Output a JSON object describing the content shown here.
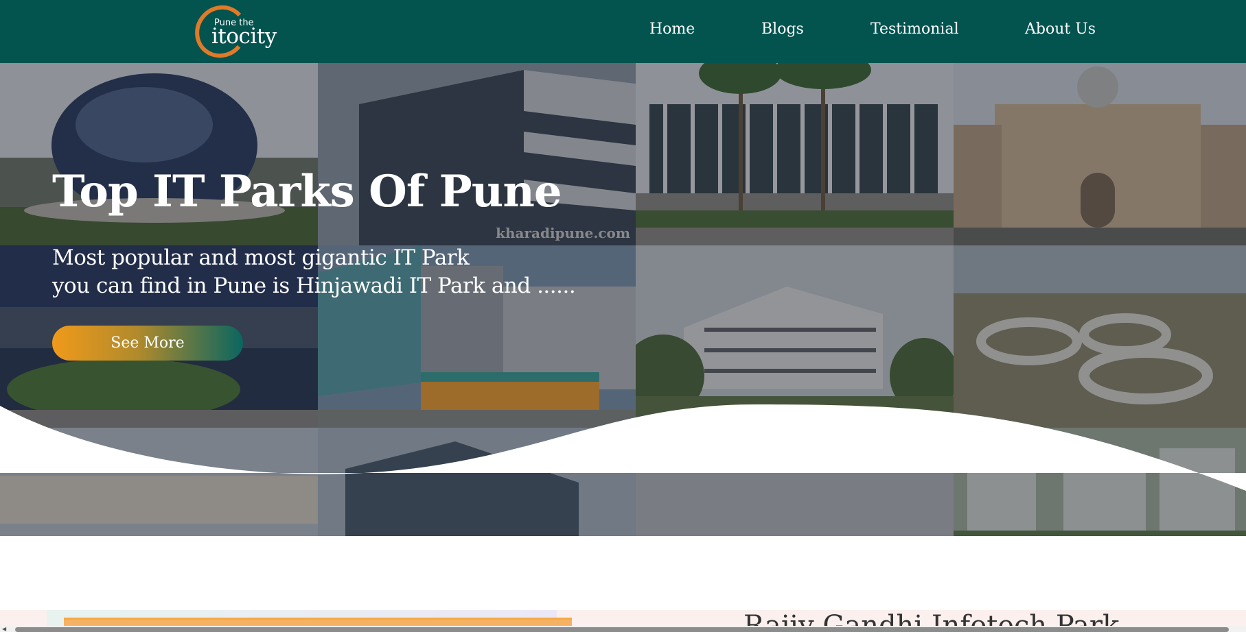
{
  "brand": {
    "tagline": "Pune the",
    "name": "itocity",
    "colors": {
      "navbar": "#03534f",
      "ring": "#e07a28",
      "button_start": "#f09a1a",
      "button_end": "#0a6660"
    }
  },
  "nav": {
    "home": "Home",
    "blogs": "Blogs",
    "testimonial": "Testimonial",
    "about": "About Us"
  },
  "hero": {
    "title": "Top IT Parks Of Pune",
    "description_line1": "Most popular and most gigantic IT Park",
    "description_line2": "you can find in Pune is Hinjawadi IT Park and ......",
    "button_label": "See More",
    "watermark": "kharadipune.com",
    "tiles": [
      {
        "name": "tile-dome-building"
      },
      {
        "name": "tile-glass-office"
      },
      {
        "name": "tile-palm-campus"
      },
      {
        "name": "tile-heritage-building"
      },
      {
        "name": "tile-night-campus"
      },
      {
        "name": "tile-mall-tower"
      },
      {
        "name": "tile-modern-block"
      },
      {
        "name": "tile-aerial-rings"
      },
      {
        "name": "tile-low-offices"
      },
      {
        "name": "tile-glass-tower"
      },
      {
        "name": "tile-plain"
      },
      {
        "name": "tile-green-campus"
      }
    ]
  },
  "next_section": {
    "heading": "Rajiv Gandhi Infotech Park"
  },
  "icons": {
    "scroll_left": "scroll-left-arrow-icon"
  }
}
